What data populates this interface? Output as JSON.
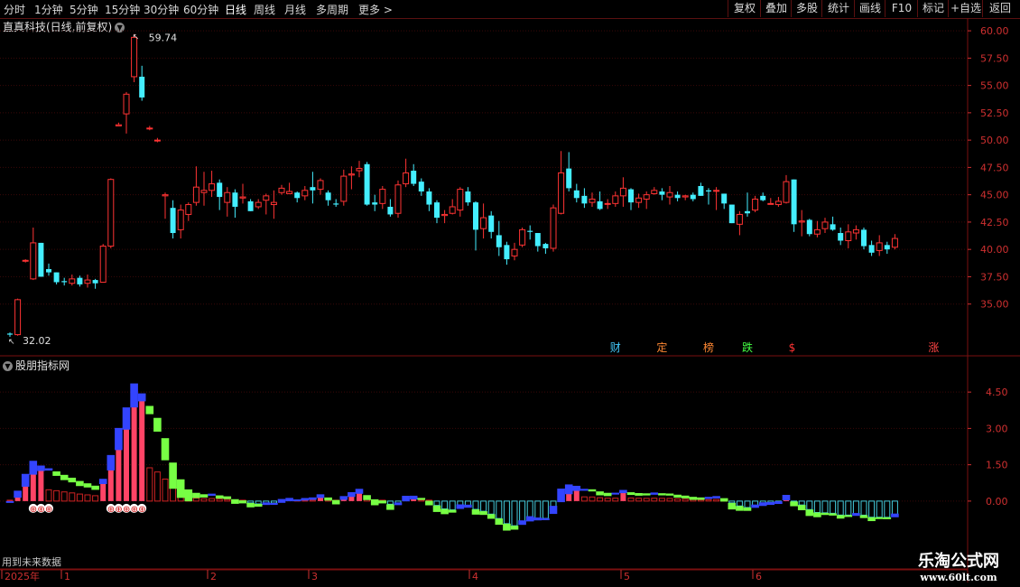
{
  "toolbar": {
    "periods": [
      "分时",
      "1分钟",
      "5分钟",
      "15分钟",
      "30分钟",
      "60分钟",
      "日线",
      "周线",
      "月线",
      "多周期",
      "更多"
    ],
    "more_arrow": ">",
    "right_buttons": [
      "复权",
      "叠加",
      "多股",
      "统计",
      "画线",
      "F10",
      "标记",
      "+自选",
      "返回"
    ]
  },
  "chart_title": "直真科技(日线,前复权)",
  "chart_title_icon": "chevron-down-icon",
  "indicator_title": "股朋指标网",
  "future_note": "用到未来数据",
  "watermark": {
    "line1": "乐淘公式网",
    "line2": "www.60lt.com"
  },
  "colors": {
    "up": "#ff3333",
    "down": "#44eeff",
    "grid": "#7a1010",
    "axis_text": "#d03030",
    "pink": "#ff4466",
    "green": "#77ff44",
    "blue": "#3344ff",
    "cyan": "#44ccdd"
  },
  "chart_data": [
    {
      "type": "candlestick",
      "y_axis": {
        "ticks": [
          "60.00",
          "57.50",
          "55.00",
          "52.50",
          "50.00",
          "47.50",
          "45.00",
          "42.50",
          "40.00",
          "37.50",
          "35.00"
        ],
        "ylim": [
          32.0,
          61.0
        ]
      },
      "annotations": {
        "high": "59.74",
        "low": "32.02"
      },
      "markers": [
        {
          "label": "财",
          "color": "#44ccff",
          "idx": 78
        },
        {
          "label": "定",
          "color": "#ff8833",
          "idx": 84
        },
        {
          "label": "榜",
          "color": "#ff8833",
          "idx": 90
        },
        {
          "label": "跌",
          "color": "#44ff44",
          "idx": 95
        },
        {
          "label": "$",
          "color": "#ff3333",
          "idx": 101
        },
        {
          "label": "涨",
          "color": "#ff4444",
          "idx": 119
        }
      ],
      "candles": [
        [
          32.3,
          32.4,
          32.0,
          32.2
        ],
        [
          32.2,
          35.5,
          32.1,
          35.4
        ],
        [
          39.0,
          39.1,
          38.8,
          39.0
        ],
        [
          37.3,
          42.0,
          37.2,
          40.6
        ],
        [
          40.6,
          40.6,
          37.5,
          37.5
        ],
        [
          38.2,
          38.7,
          37.6,
          37.9
        ],
        [
          37.9,
          37.9,
          36.8,
          37.0
        ],
        [
          37.1,
          37.4,
          36.7,
          37.0
        ],
        [
          36.9,
          37.7,
          36.7,
          37.3
        ],
        [
          37.4,
          37.6,
          36.6,
          36.8
        ],
        [
          36.9,
          37.7,
          36.5,
          37.2
        ],
        [
          37.2,
          37.3,
          36.4,
          36.9
        ],
        [
          37.0,
          40.5,
          37.0,
          40.3
        ],
        [
          40.3,
          46.5,
          40.1,
          46.4
        ],
        [
          51.3,
          51.6,
          51.3,
          51.4
        ],
        [
          52.4,
          54.4,
          50.6,
          54.2
        ],
        [
          55.8,
          59.7,
          55.3,
          59.4
        ],
        [
          55.8,
          56.8,
          53.6,
          53.9
        ],
        [
          51.1,
          51.3,
          50.9,
          51.1
        ],
        [
          50.0,
          50.2,
          49.8,
          50.0
        ],
        [
          44.9,
          45.2,
          42.8,
          45.0
        ],
        [
          43.8,
          44.5,
          41.0,
          41.5
        ],
        [
          41.8,
          44.1,
          41.0,
          43.6
        ],
        [
          43.2,
          44.3,
          42.6,
          44.1
        ],
        [
          44.3,
          47.6,
          44.0,
          45.7
        ],
        [
          45.2,
          47.1,
          44.0,
          45.4
        ],
        [
          45.4,
          47.2,
          44.8,
          46.0
        ],
        [
          46.1,
          46.4,
          43.6,
          44.8
        ],
        [
          44.3,
          45.7,
          43.0,
          45.2
        ],
        [
          45.2,
          45.5,
          42.9,
          43.9
        ],
        [
          44.7,
          46.0,
          44.2,
          44.8
        ],
        [
          44.4,
          44.6,
          43.5,
          43.5
        ],
        [
          43.9,
          44.6,
          43.7,
          44.3
        ],
        [
          44.5,
          45.1,
          43.2,
          44.9
        ],
        [
          44.1,
          45.4,
          42.8,
          44.3
        ],
        [
          45.2,
          45.9,
          45.0,
          45.6
        ],
        [
          45.1,
          46.1,
          45.1,
          45.3
        ],
        [
          45.2,
          45.3,
          44.3,
          44.7
        ],
        [
          44.9,
          45.8,
          44.5,
          45.4
        ],
        [
          45.7,
          47.1,
          44.2,
          45.4
        ],
        [
          45.5,
          46.5,
          45.0,
          46.3
        ],
        [
          45.2,
          45.4,
          44.0,
          44.5
        ],
        [
          44.2,
          44.6,
          43.9,
          44.1
        ],
        [
          44.4,
          47.3,
          44.0,
          46.7
        ],
        [
          46.8,
          47.6,
          45.5,
          46.9
        ],
        [
          47.2,
          48.1,
          46.6,
          47.4
        ],
        [
          47.8,
          48.0,
          44.0,
          44.1
        ],
        [
          44.3,
          45.0,
          43.5,
          44.1
        ],
        [
          44.2,
          45.8,
          43.7,
          45.5
        ],
        [
          43.9,
          44.6,
          43.0,
          43.2
        ],
        [
          43.3,
          46.3,
          42.9,
          45.9
        ],
        [
          46.0,
          48.3,
          45.7,
          47.0
        ],
        [
          47.2,
          47.8,
          45.8,
          46.0
        ],
        [
          46.2,
          46.5,
          44.9,
          45.3
        ],
        [
          45.3,
          45.6,
          43.5,
          44.1
        ],
        [
          44.3,
          44.5,
          42.4,
          42.9
        ],
        [
          43.1,
          43.6,
          42.4,
          43.2
        ],
        [
          43.3,
          44.6,
          43.2,
          43.9
        ],
        [
          43.6,
          45.7,
          43.0,
          45.5
        ],
        [
          45.3,
          45.7,
          44.0,
          44.3
        ],
        [
          44.3,
          44.4,
          39.9,
          41.8
        ],
        [
          41.9,
          44.2,
          41.0,
          42.9
        ],
        [
          43.1,
          43.5,
          41.0,
          41.6
        ],
        [
          41.3,
          42.6,
          39.4,
          40.2
        ],
        [
          40.4,
          40.7,
          38.6,
          39.1
        ],
        [
          39.4,
          40.6,
          39.0,
          40.0
        ],
        [
          40.4,
          42.0,
          40.2,
          41.8
        ],
        [
          41.7,
          42.2,
          40.9,
          41.6
        ],
        [
          41.5,
          41.5,
          39.8,
          40.3
        ],
        [
          40.5,
          40.6,
          39.6,
          40.1
        ],
        [
          40.1,
          44.1,
          39.8,
          43.8
        ],
        [
          43.3,
          49.0,
          43.2,
          47.0
        ],
        [
          47.4,
          48.9,
          45.3,
          45.6
        ],
        [
          45.4,
          46.0,
          44.3,
          44.7
        ],
        [
          44.9,
          45.6,
          43.8,
          44.2
        ],
        [
          44.3,
          45.2,
          43.9,
          44.6
        ],
        [
          44.4,
          45.3,
          43.6,
          43.7
        ],
        [
          44.2,
          44.6,
          43.7,
          44.2
        ],
        [
          44.2,
          45.3,
          43.9,
          44.9
        ],
        [
          44.9,
          46.6,
          43.9,
          45.6
        ],
        [
          45.5,
          45.6,
          43.6,
          44.3
        ],
        [
          44.3,
          45.1,
          43.8,
          44.7
        ],
        [
          44.6,
          45.3,
          43.7,
          45.0
        ],
        [
          45.1,
          45.7,
          45.0,
          45.4
        ],
        [
          45.3,
          45.6,
          44.5,
          45.0
        ],
        [
          44.8,
          45.8,
          44.1,
          45.2
        ],
        [
          45.0,
          45.3,
          44.4,
          44.7
        ],
        [
          44.8,
          45.0,
          44.5,
          44.9
        ],
        [
          45.0,
          45.2,
          44.4,
          44.6
        ],
        [
          45.8,
          46.1,
          44.9,
          44.9
        ],
        [
          45.4,
          45.6,
          44.1,
          45.3
        ],
        [
          45.4,
          45.7,
          43.6,
          45.4
        ],
        [
          45.1,
          45.1,
          43.7,
          44.2
        ],
        [
          44.1,
          44.1,
          42.4,
          42.4
        ],
        [
          42.3,
          43.5,
          41.3,
          43.2
        ],
        [
          43.5,
          45.2,
          43.0,
          43.3
        ],
        [
          43.6,
          44.9,
          43.4,
          44.6
        ],
        [
          44.9,
          45.2,
          44.4,
          44.5
        ],
        [
          44.2,
          44.7,
          44.1,
          44.2
        ],
        [
          44.1,
          44.8,
          43.9,
          44.4
        ],
        [
          44.3,
          46.8,
          44.2,
          46.2
        ],
        [
          46.4,
          46.4,
          41.6,
          42.3
        ],
        [
          42.5,
          43.6,
          41.2,
          42.6
        ],
        [
          42.7,
          42.8,
          41.2,
          41.4
        ],
        [
          41.4,
          42.6,
          41.1,
          41.8
        ],
        [
          41.9,
          42.9,
          41.5,
          42.5
        ],
        [
          42.3,
          43.0,
          41.7,
          41.8
        ],
        [
          41.5,
          42.0,
          40.4,
          40.8
        ],
        [
          40.8,
          42.3,
          40.1,
          41.6
        ],
        [
          41.5,
          42.2,
          40.9,
          41.8
        ],
        [
          41.8,
          42.0,
          40.0,
          40.3
        ],
        [
          40.4,
          40.8,
          39.4,
          39.7
        ],
        [
          39.9,
          41.3,
          39.4,
          40.6
        ],
        [
          40.4,
          40.7,
          39.6,
          40.0
        ],
        [
          40.2,
          41.4,
          40.0,
          41.0
        ]
      ]
    },
    {
      "type": "bar",
      "y_axis": {
        "ticks": [
          "4.50",
          "3.00",
          "1.50",
          "0.00"
        ],
        "ylim": [
          -2.8,
          5.4
        ]
      },
      "symbol_rows": [
        {
          "glyph": "⊕"
        }
      ]
    }
  ],
  "bottom_axis": {
    "labels": [
      "2025年",
      "1",
      "2",
      "3",
      "4",
      "5",
      "6"
    ]
  }
}
